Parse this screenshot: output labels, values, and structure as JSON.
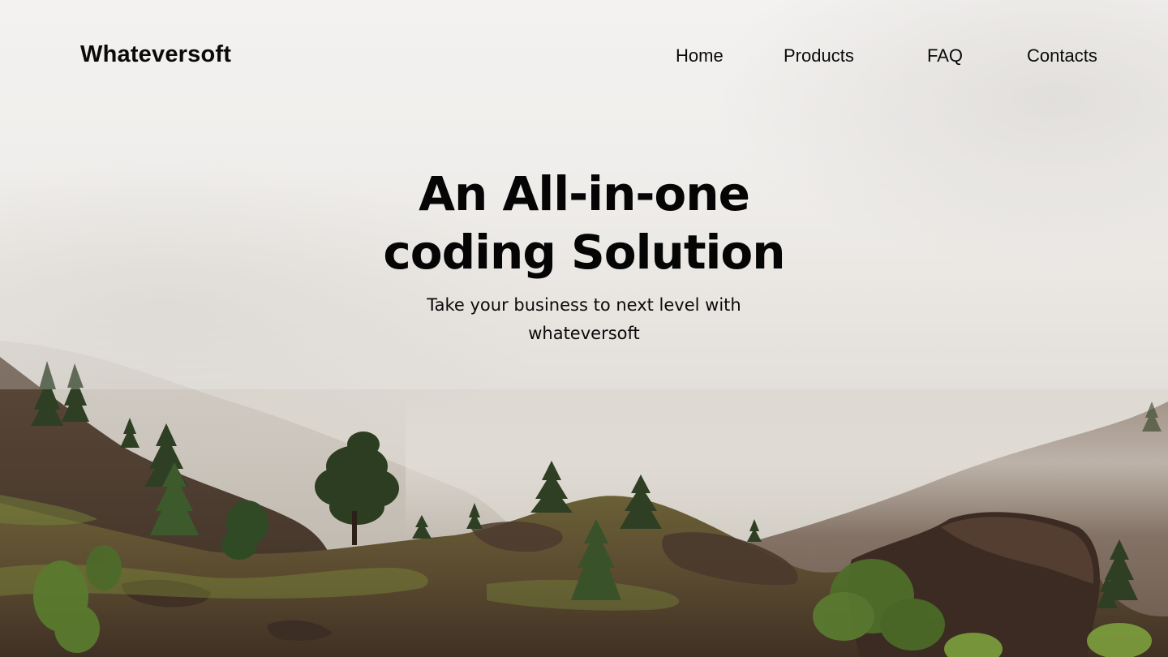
{
  "header": {
    "brand": "Whateversoft",
    "nav": [
      {
        "label": "Home"
      },
      {
        "label": "Products"
      },
      {
        "label": "FAQ"
      },
      {
        "label": "Contacts"
      }
    ]
  },
  "hero": {
    "title_line1": "An All-in-one",
    "title_line2": "coding Solution",
    "subtitle": "Take your business to next level with whateversoft"
  },
  "background": {
    "description_icon": "misty-mountain-landscape-image",
    "colors": {
      "sky": "#efeeeb",
      "hill_dark": "#4a3a30",
      "grass": "#6e7a3c",
      "tree": "#3f5a2c"
    }
  }
}
